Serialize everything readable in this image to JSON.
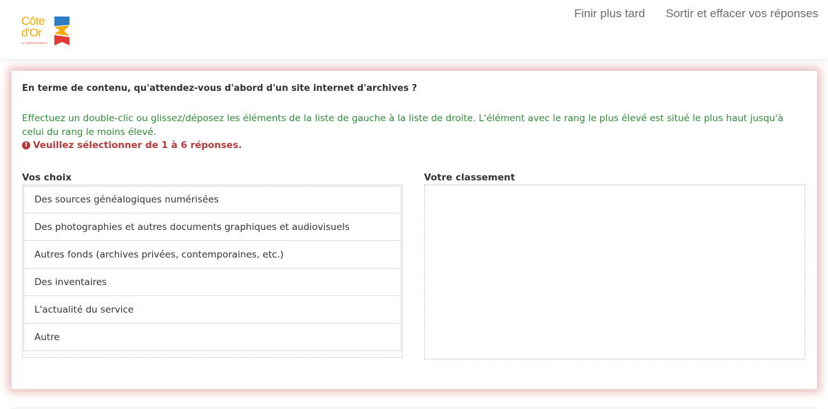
{
  "header": {
    "logo_line1": "Côte",
    "logo_line2": "d'Or",
    "logo_subtitle": "LE DÉPARTEMENT",
    "finish_later": "Finir plus tard",
    "exit_clear": "Sortir et effacer vos réponses"
  },
  "question": {
    "title": "En terme de contenu, qu'attendez-vous d'abord d'un site internet d'archives ?",
    "help": "Effectuez un double-clic ou glissez/déposez les éléments de la liste de gauche à la liste de droite. L'élément avec le rang le plus élevé est situé le plus haut jusqu'à celui du rang le moins élevé.",
    "error_icon": "!",
    "error": "Veuillez sélectionner de 1 à 6 réponses.",
    "choices_label": "Vos choix",
    "ranking_label": "Votre classement",
    "choices": [
      "Des sources généalogiques numérisées",
      "Des photographies et autres documents graphiques et audiovisuels",
      "Autres fonds (archives privées, contemporaines, etc.)",
      "Des inventaires",
      "L'actualité du service",
      "Autre"
    ]
  },
  "colors": {
    "help_text": "#2e8b38",
    "error_text": "#b23b3b",
    "panel_glow": "#c43c46",
    "logo_yellow": "#f2a900",
    "logo_red": "#e23b33",
    "logo_blue": "#2e7cc4"
  },
  "icons": {
    "error": "exclamation-circle-icon",
    "logo": "cote-dor-logo"
  }
}
